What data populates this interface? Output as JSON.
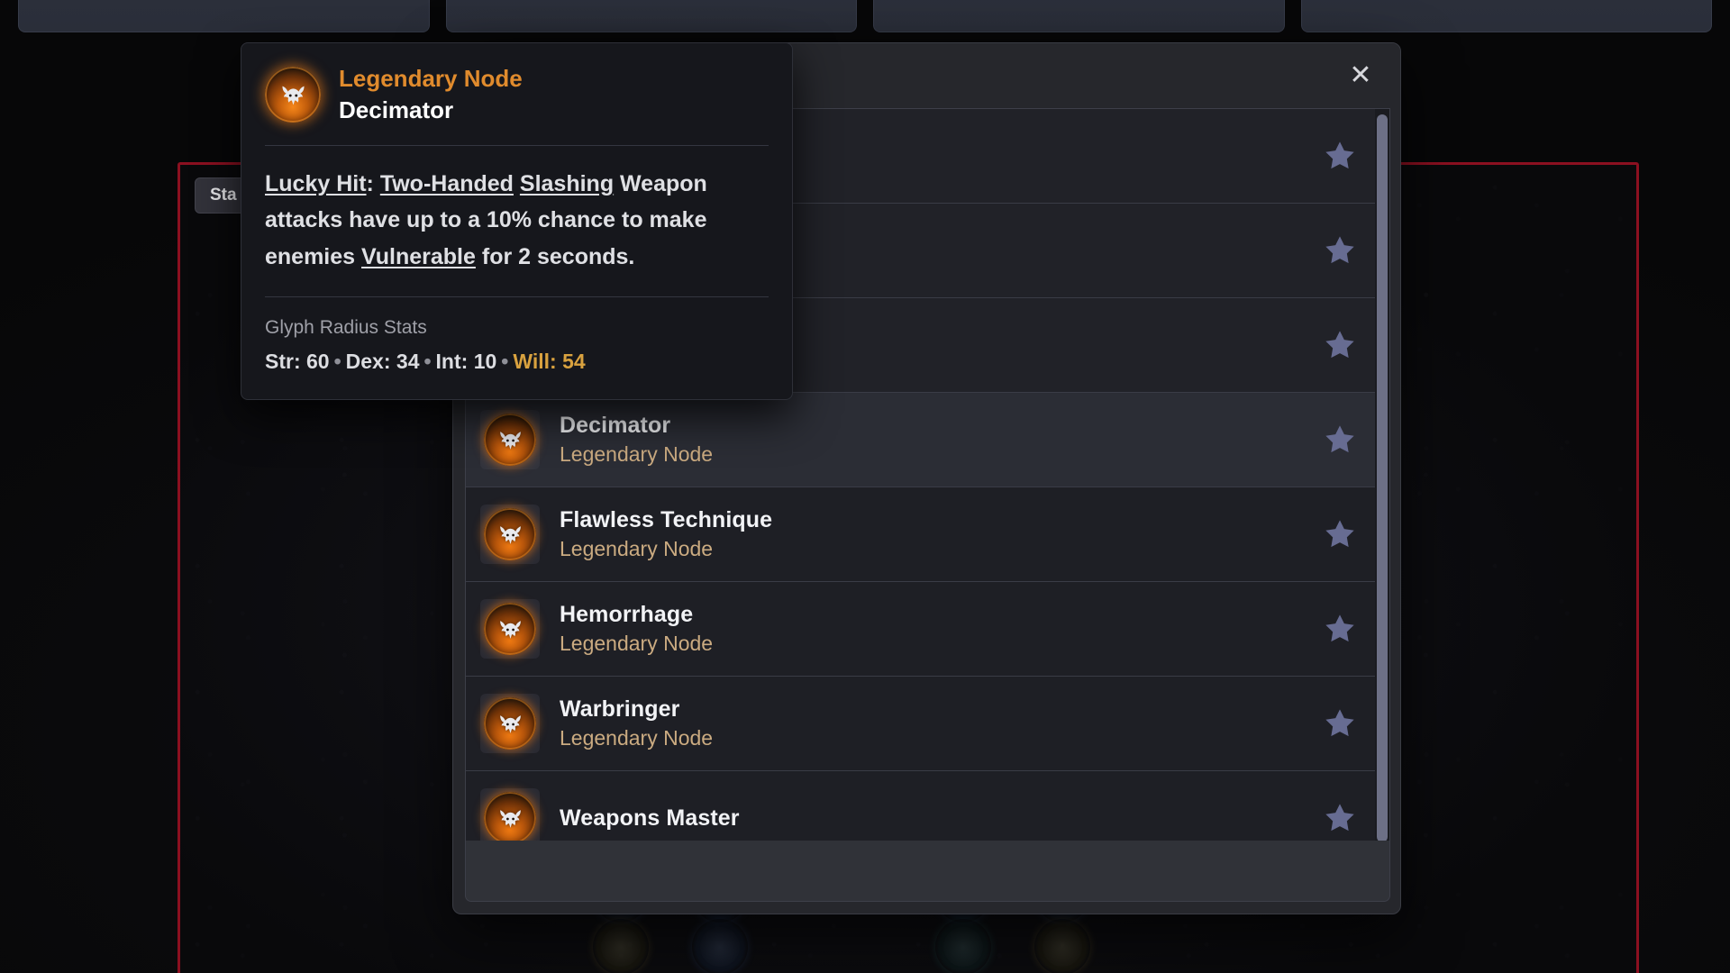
{
  "top_bar": {
    "cards": [
      "",
      "",
      "",
      ""
    ]
  },
  "tree": {
    "stats_button_label": "Sta",
    "border_color": "#8b1020"
  },
  "modal": {
    "close_label": "✕",
    "rows": [
      {
        "title": "",
        "subtitle": "",
        "starred": false,
        "hidden_behind_tooltip": true
      },
      {
        "title": "",
        "subtitle": "",
        "starred": false,
        "hidden_behind_tooltip": true
      },
      {
        "title": "",
        "subtitle": "",
        "starred": false,
        "hidden_behind_tooltip": true
      },
      {
        "title": "Decimator",
        "subtitle": "Legendary Node",
        "starred": false,
        "hovered": true
      },
      {
        "title": "Flawless Technique",
        "subtitle": "Legendary Node",
        "starred": false
      },
      {
        "title": "Hemorrhage",
        "subtitle": "Legendary Node",
        "starred": false
      },
      {
        "title": "Warbringer",
        "subtitle": "Legendary Node",
        "starred": false
      },
      {
        "title": "Weapons Master",
        "subtitle": "",
        "starred": false
      }
    ],
    "icon_name": "legendary-node-orb-icon",
    "star_icon_name": "favorite-star-icon"
  },
  "tooltip": {
    "kind": "Legendary Node",
    "name": "Decimator",
    "description_html": "<u>Lucky Hit</u>: <u>Two-Handed</u> <u>Slashing</u> Weapon attacks have up to a 10% chance to make enemies <u>Vulnerable</u> for 2 seconds.",
    "footer_label": "Glyph Radius Stats",
    "stats": [
      {
        "label": "Str",
        "value": "60"
      },
      {
        "label": "Dex",
        "value": "34"
      },
      {
        "label": "Int",
        "value": "10"
      },
      {
        "label": "Will",
        "value": "54",
        "highlight": true
      }
    ],
    "accent_color": "#e08b2d",
    "will_color": "#d9a23f"
  }
}
